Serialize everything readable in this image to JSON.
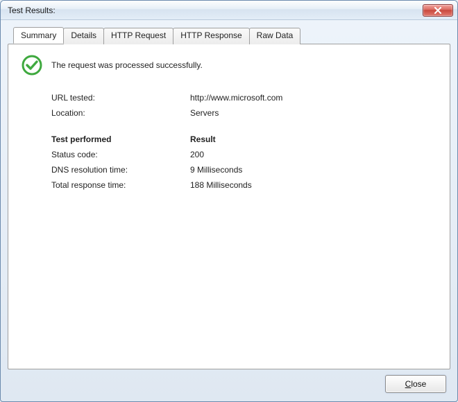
{
  "window": {
    "title": "Test Results:"
  },
  "tabs": [
    "Summary",
    "Details",
    "HTTP Request",
    "HTTP Response",
    "Raw Data"
  ],
  "active_tab": 0,
  "status": {
    "icon": "check-circle",
    "message": "The request was processed successfully."
  },
  "info": {
    "url_label": "URL tested:",
    "url_value": "http://www.microsoft.com",
    "location_label": "Location:",
    "location_value": "Servers"
  },
  "results": {
    "header_test": "Test performed",
    "header_result": "Result",
    "rows": [
      {
        "label": "Status code:",
        "value": "200"
      },
      {
        "label": "DNS resolution time:",
        "value": "9 Milliseconds"
      },
      {
        "label": "Total response time:",
        "value": "188 Milliseconds"
      }
    ]
  },
  "buttons": {
    "close": "Close",
    "close_mnemonic": "C",
    "close_rest": "lose"
  }
}
